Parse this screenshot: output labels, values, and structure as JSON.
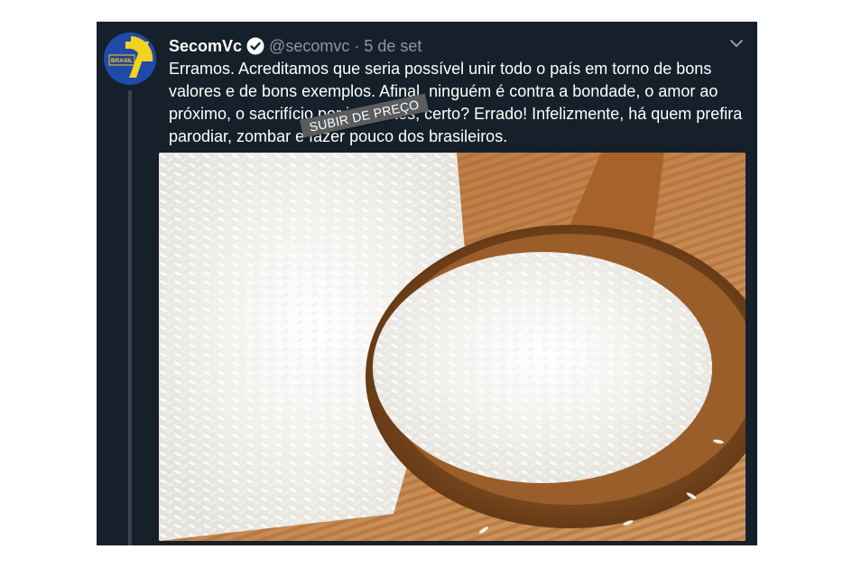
{
  "tweet": {
    "author_name": "SecomVc",
    "handle": "@secomvc",
    "separator": "·",
    "date": "5 de set",
    "text": "Erramos. Acreditamos que seria possível unir todo o país em torno de bons valores e de bons exemplos. Afinal, ninguém é contra a bondade, o amor ao próximo, o sacrifício por inocentes, certo? Errado! Infelizmente, há quem prefira parodiar, zombar e fazer pouco dos brasileiros.",
    "avatar_text": "BRASIL",
    "overlay_stamp": "SUBIR DE PREÇO",
    "media_alt": "rice-in-wooden-spoon-photo"
  },
  "colors": {
    "tweet_bg": "#15202b",
    "text": "#ffffff",
    "secondary_text": "#8899a6",
    "avatar_bg": "#1f4aa8",
    "avatar_accent": "#f1d31f"
  },
  "icons": {
    "verified": "verified-badge-icon",
    "menu": "chevron-down-icon"
  }
}
